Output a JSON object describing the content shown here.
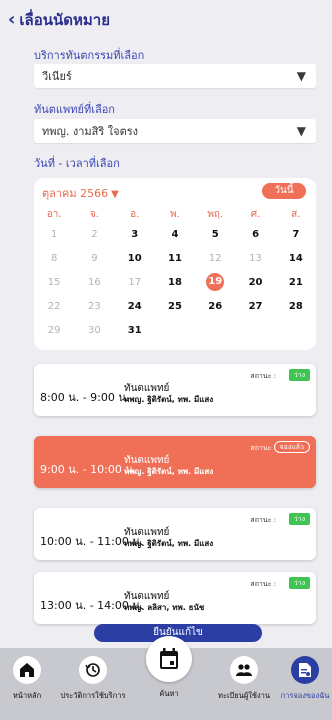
{
  "header": {
    "title": "เลื่อนนัดหมาย"
  },
  "service": {
    "label": "บริการทันตกรรมที่เลือก",
    "value": "วีเนียร์"
  },
  "dentist": {
    "label": "ทันตแพทย์ที่เลือก",
    "value": "ทพญ. งามสิริ ใจตรง"
  },
  "datetime": {
    "label": "วันที่ - เวลาที่เลือก"
  },
  "calendar": {
    "month": "ตุลาคม 2566",
    "today_label": "วันนี้",
    "weekdays": [
      "อา.",
      "จ.",
      "อ.",
      "พ.",
      "พฤ.",
      "ศ.",
      "ส."
    ],
    "weeks": [
      [
        "1",
        "2",
        "3",
        "4",
        "5",
        "6",
        "7"
      ],
      [
        "8",
        "9",
        "10",
        "11",
        "12",
        "13",
        "14"
      ],
      [
        "15",
        "16",
        "17",
        "18",
        "19",
        "20",
        "21"
      ],
      [
        "22",
        "23",
        "24",
        "25",
        "26",
        "27",
        "28"
      ],
      [
        "29",
        "30",
        "31",
        "",
        "",
        "",
        ""
      ]
    ],
    "selected_day": "19"
  },
  "slots": [
    {
      "time": "8:00 น. - 9:00 น.",
      "doc_label": "ทันตแพทย์",
      "doc_name": "ทพญ. ฐิติรัตน์, ทพ. มีแสง",
      "status_label": "สถานะ :",
      "status": "ว่าง",
      "selected": false
    },
    {
      "time": "9:00 น. - 10:00 น.",
      "doc_label": "ทันตแพทย์",
      "doc_name": "ทพญ. ฐิติรัตน์, ทพ. มีแสง",
      "status_label": "สถานะ :",
      "status": "จองแล้ว",
      "selected": true
    },
    {
      "time": "10:00 น. - 11:00 น.",
      "doc_label": "ทันตแพทย์",
      "doc_name": "ทพญ. ฐิติรัตน์, ทพ. มีแสง",
      "status_label": "สถานะ :",
      "status": "ว่าง",
      "selected": false
    },
    {
      "time": "13:00 น. - 14:00 น.",
      "doc_label": "ทันตแพทย์",
      "doc_name": "ทพญ. ลลิสา, ทพ. ธนัช",
      "status_label": "สถานะ :",
      "status": "ว่าง",
      "selected": false
    }
  ],
  "confirm": {
    "label": "ยืนยันแก้ไข"
  },
  "nav": {
    "home": "หน้าหลัก",
    "history": "ประวัติการใช้บริการ",
    "search": "ค้นหา",
    "register": "ทะเบียนผู้ใช้งาน",
    "booking": "การจองของฉัน"
  },
  "colors": {
    "primary": "#2b3ea3",
    "accent": "#ef6f57",
    "free": "#3fc451"
  }
}
